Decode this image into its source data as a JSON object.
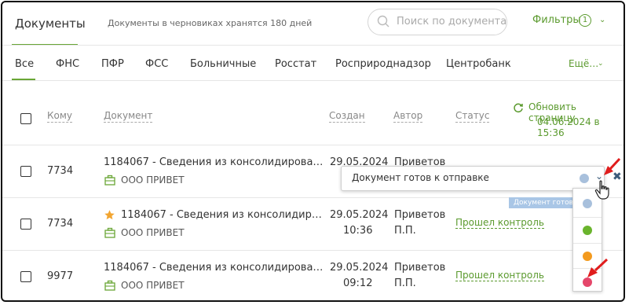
{
  "header": {
    "title": "Документы",
    "note": "Документы в черновиках хранятся 180 дней",
    "search_placeholder": "Поиск по документа",
    "filters_label": "Фильтры",
    "filters_count": "1"
  },
  "tabs": [
    "Все",
    "ФНС",
    "ПФР",
    "ФСС",
    "Больничные",
    "Росстат",
    "Росприроднадзор",
    "Центробанк"
  ],
  "more_label": "Ещё…",
  "columns": {
    "to": "Кому",
    "document": "Документ",
    "created": "Создан",
    "author": "Автор",
    "status": "Статус"
  },
  "refresh": {
    "label": "Обновить страницу",
    "datetime": "04.06.2024 в 15:36"
  },
  "rows": [
    {
      "to": "7734",
      "doc": "1184067 - Сведения из консолидирова…",
      "org": "ООО ПРИВЕТ",
      "date": "29.05.2024",
      "time": "",
      "author1": "Приветов",
      "author2": "",
      "status": ""
    },
    {
      "to": "7734",
      "doc": "1184067 - Сведения из консолидир…",
      "org": "ООО ПРИВЕТ",
      "date": "29.05.2024",
      "time": "10:36",
      "author1": "Приветов",
      "author2": "П.П.",
      "status": "Прошел контроль"
    },
    {
      "to": "9977",
      "doc": "1184067 - Сведения из консолидирова…",
      "org": "ООО ПРИВЕТ",
      "date": "29.05.2024",
      "time": "09:12",
      "author1": "Приветов",
      "author2": "П.П.",
      "status": "Прошел контроль"
    }
  ],
  "popup": {
    "text": "Документ готов к отправке",
    "tooltip": "Документ готов к отправке"
  },
  "color_options": [
    "#a8c0dc",
    "#6ab42d",
    "#f39a1e",
    "#e5466a"
  ],
  "colors": {
    "accent": "#5b9a2e",
    "star": "#f2a531",
    "arrow": "#e01d1d"
  }
}
